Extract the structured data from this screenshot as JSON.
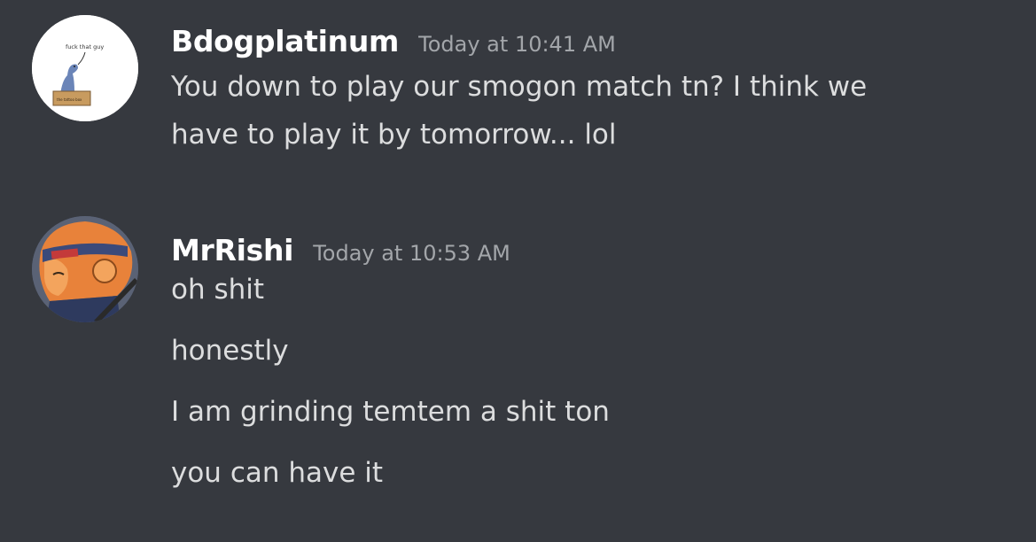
{
  "messages": [
    {
      "author": "Bdogplatinum",
      "timestamp": "Today at 10:41 AM",
      "avatar": {
        "name": "dinosaur-in-box-avatar",
        "caption": "fuck that guy",
        "box_label": "the tattoo box"
      },
      "lines": [
        "You down to play our smogon match tn? I think we",
        "have to play it by tomorrow... lol"
      ]
    },
    {
      "author": "MrRishi",
      "timestamp": "Today at 10:53 AM",
      "avatar": {
        "name": "orange-ninja-character-avatar"
      },
      "lines": [
        "oh shit",
        "honestly",
        "I am grinding temtem a shit ton",
        "you can have it"
      ]
    }
  ],
  "colors": {
    "background": "#36393f",
    "username": "#ffffff",
    "timestamp": "#a3a6aa",
    "message_text": "#dcddde"
  }
}
